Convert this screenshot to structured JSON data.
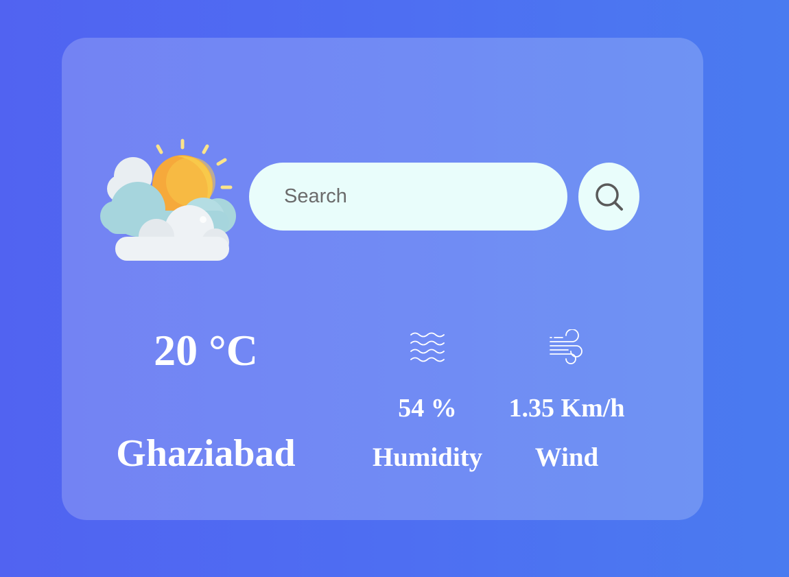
{
  "colors": {
    "background_start": "#5163f1",
    "background_end": "#4a7bf0",
    "search_field": "#e9fdfb",
    "text": "#ffffff"
  },
  "weather": {
    "icon": "partly-cloudy-sun-icon",
    "temperature": "20 °C",
    "city": "Ghaziabad"
  },
  "search": {
    "placeholder": "Search",
    "value": "",
    "button_icon": "search-icon"
  },
  "humidity": {
    "icon": "humidity-waves-icon",
    "value": "54 %",
    "label": "Humidity"
  },
  "wind": {
    "icon": "wind-icon",
    "value": "1.35 Km/h",
    "label": "Wind"
  }
}
